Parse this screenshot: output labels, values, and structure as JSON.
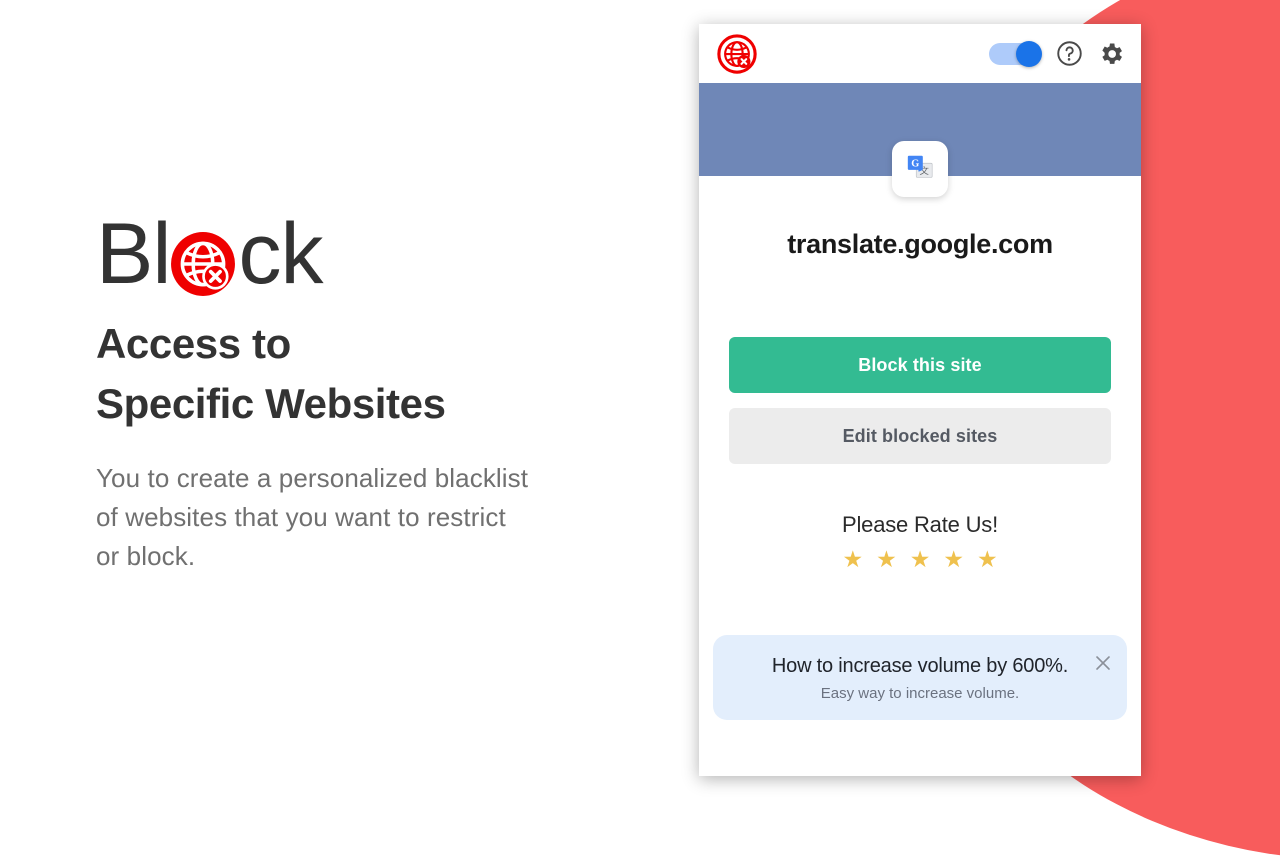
{
  "theme": {
    "accent_red": "#f85c5c",
    "brand_red": "#ef0000",
    "band_blue": "#6f87b7",
    "block_green": "#33bb92",
    "toggle_blue": "#1a73e8",
    "star_gold": "#efc14e",
    "banner_blue": "#e3eefc"
  },
  "promo": {
    "title_before": "Bl",
    "title_logo_icon": "globe-block-icon",
    "title_after": "ck",
    "subtitle_line1": "Access to",
    "subtitle_line2": "Specific Websites",
    "body": "You to create a personalized blacklist of websites that you want to restrict or block."
  },
  "popup": {
    "header": {
      "logo_icon": "globe-block-icon",
      "toggle": {
        "name": "enable-toggle",
        "state": "on"
      },
      "help_icon": "question-circle-icon",
      "settings_icon": "gear-icon"
    },
    "site": {
      "favicon_icon": "google-translate-icon",
      "domain": "translate.google.com"
    },
    "actions": {
      "block_label": "Block this site",
      "edit_label": "Edit blocked sites"
    },
    "rating": {
      "title": "Please Rate Us!",
      "stars": [
        "★",
        "★",
        "★",
        "★",
        "★"
      ],
      "star_count": 5
    },
    "banner": {
      "title": "How to increase volume by 600%.",
      "subtitle": "Easy way to increase volume.",
      "close_icon": "close-icon"
    }
  }
}
